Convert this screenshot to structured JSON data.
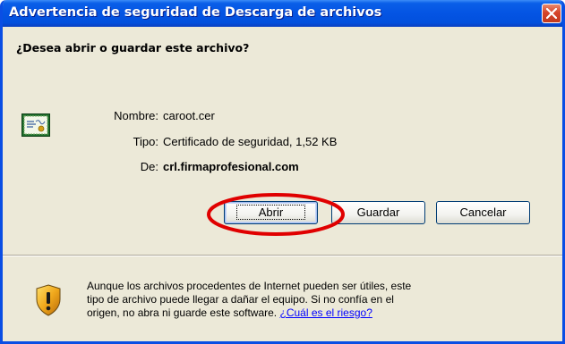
{
  "window": {
    "title": "Advertencia de seguridad de Descarga de archivos"
  },
  "dialog": {
    "question": "¿Desea abrir o guardar este archivo?",
    "file": {
      "name_label": "Nombre:",
      "name_value": "caroot.cer",
      "type_label": "Tipo:",
      "type_value": "Certificado de seguridad, 1,52 KB",
      "from_label": "De:",
      "from_value": "crl.firmaprofesional.com"
    },
    "buttons": {
      "open": "Abrir",
      "save": "Guardar",
      "cancel": "Cancelar"
    },
    "warning": {
      "line1": "Aunque los archivos procedentes de Internet pueden ser útiles, este",
      "line2": "tipo de archivo puede llegar a dañar el equipo. Si no confía en el",
      "line3_text": "origen, no abra ni guarde este software.",
      "risk_link": "¿Cuál es el riesgo?"
    }
  },
  "icons": {
    "close": "close-icon",
    "certificate": "certificate-icon",
    "warning_shield": "shield-warning-icon"
  },
  "colors": {
    "titlebar": "#0454e3",
    "window_bg": "#ece9d8",
    "close_button": "#d6442a",
    "highlight_ellipse": "#e00000",
    "link": "#0000ff"
  }
}
